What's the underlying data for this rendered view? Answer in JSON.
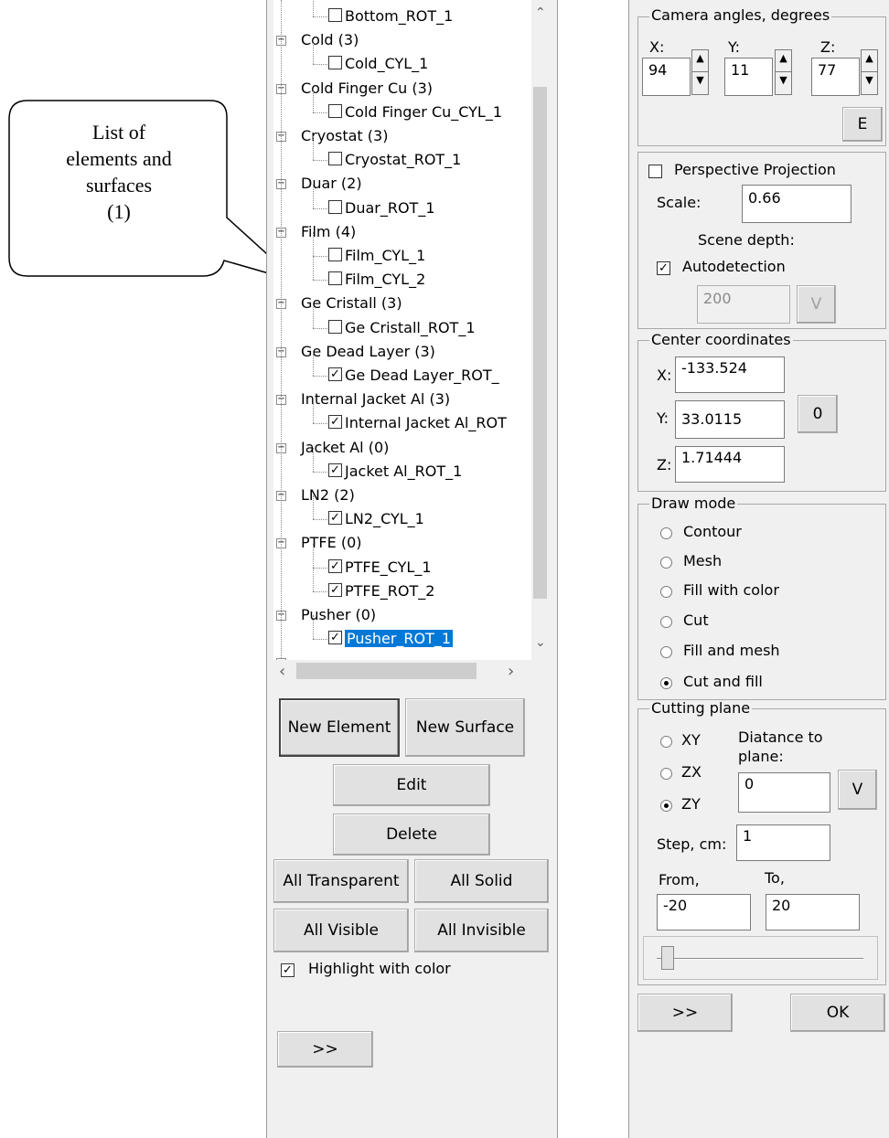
{
  "callout": {
    "text": "List of elements and surfaces (1)",
    "lines": [
      "List of",
      "elements and",
      "surfaces",
      "(1)"
    ]
  },
  "tree": {
    "nodes": [
      {
        "label": "Bottom_ROT_1",
        "level": 1,
        "checked": false
      },
      {
        "label": "Cold (3)",
        "level": 0
      },
      {
        "label": "Cold_CYL_1",
        "level": 1,
        "checked": false
      },
      {
        "label": "Cold Finger Cu (3)",
        "level": 0
      },
      {
        "label": "Cold Finger Cu_CYL_1",
        "level": 1,
        "checked": false
      },
      {
        "label": "Cryostat (3)",
        "level": 0
      },
      {
        "label": "Cryostat_ROT_1",
        "level": 1,
        "checked": false
      },
      {
        "label": "Duar (2)",
        "level": 0
      },
      {
        "label": "Duar_ROT_1",
        "level": 1,
        "checked": false
      },
      {
        "label": "Film (4)",
        "level": 0
      },
      {
        "label": "Film_CYL_1",
        "level": 1,
        "checked": false
      },
      {
        "label": "Film_CYL_2",
        "level": 1,
        "checked": false
      },
      {
        "label": "Ge Cristall (3)",
        "level": 0
      },
      {
        "label": "Ge Cristall_ROT_1",
        "level": 1,
        "checked": false
      },
      {
        "label": "Ge Dead Layer (3)",
        "level": 0
      },
      {
        "label": "Ge Dead Layer_ROT_",
        "level": 1,
        "checked": true
      },
      {
        "label": "Internal Jacket Al (3)",
        "level": 0
      },
      {
        "label": "Internal Jacket Al_ROT",
        "level": 1,
        "checked": true
      },
      {
        "label": "Jacket Al (0)",
        "level": 0
      },
      {
        "label": "Jacket Al_ROT_1",
        "level": 1,
        "checked": true
      },
      {
        "label": "LN2 (2)",
        "level": 0
      },
      {
        "label": "LN2_CYL_1",
        "level": 1,
        "checked": true
      },
      {
        "label": "PTFE (0)",
        "level": 0
      },
      {
        "label": "PTFE_CYL_1",
        "level": 1,
        "checked": true
      },
      {
        "label": "PTFE_ROT_2",
        "level": 1,
        "checked": true
      },
      {
        "label": "Pusher (0)",
        "level": 0
      },
      {
        "label": "Pusher_ROT_1",
        "level": 1,
        "checked": true,
        "selected": true
      }
    ]
  },
  "left_buttons": {
    "new_element": "New Element",
    "new_surface": "New Surface",
    "edit": "Edit",
    "delete": "Delete",
    "all_transparent": "All Transparent",
    "all_solid": "All Solid",
    "all_visible": "All Visible",
    "all_invisible": "All Invisible",
    "highlight": "Highlight with color",
    "more": ">>"
  },
  "camera": {
    "title": "Camera angles, degrees",
    "x_label": "X:",
    "x_value": "94",
    "y_label": "Y:",
    "y_value": "11",
    "z_label": "Z:",
    "z_value": "77",
    "e_button": "E"
  },
  "projection": {
    "perspective_label": "Perspective Projection",
    "scale_label": "Scale:",
    "scale_value": "0.66",
    "scene_depth_label": "Scene depth:",
    "autodetection_label": "Autodetection",
    "depth_value": "200",
    "v_button": "V"
  },
  "center": {
    "title": "Center coordinates",
    "x_label": "X:",
    "x_value": "-133.524",
    "y_label": "Y:",
    "y_value": "33.0115",
    "z_label": "Z:",
    "z_value": "1.71444",
    "zero_button": "0"
  },
  "draw_mode": {
    "title": "Draw mode",
    "options": [
      "Contour",
      "Mesh",
      "Fill with color",
      "Cut",
      "Fill and mesh",
      "Cut and fill"
    ],
    "selected": "Cut and fill"
  },
  "cutting": {
    "title": "Cutting plane",
    "planes": [
      "XY",
      "ZX",
      "ZY"
    ],
    "selected": "ZY",
    "distance_label": "Diatance to plane:",
    "distance_value": "0",
    "v_button": "V",
    "step_label": "Step, cm:",
    "step_value": "1",
    "from_label": "From,",
    "from_value": "-20",
    "to_label": "To,",
    "to_value": "20"
  },
  "right_buttons": {
    "more": ">>",
    "ok": "OK"
  }
}
